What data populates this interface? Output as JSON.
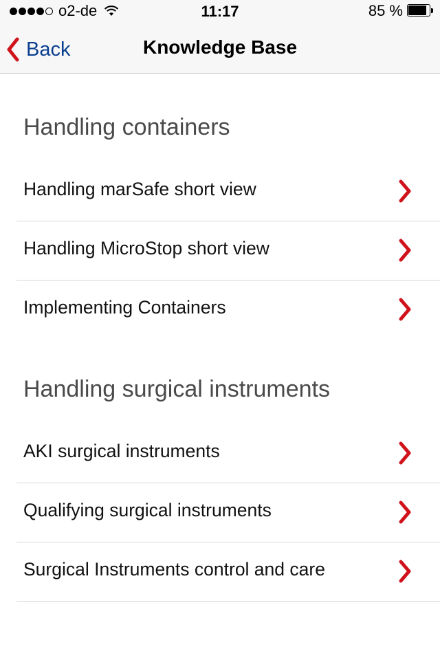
{
  "status_bar": {
    "carrier": "o2-de",
    "time": "11:17",
    "battery_percent": "85 %",
    "battery_level": 0.85,
    "signal_bars_filled": 4,
    "signal_bars_total": 5
  },
  "nav": {
    "back_label": "Back",
    "title": "Knowledge Base"
  },
  "sections": [
    {
      "header": "Handling containers",
      "items": [
        {
          "label": "Handling marSafe short view"
        },
        {
          "label": "Handling MicroStop short view"
        },
        {
          "label": "Implementing Containers"
        }
      ]
    },
    {
      "header": "Handling surgical instruments",
      "items": [
        {
          "label": "AKI surgical instruments"
        },
        {
          "label": "Qualifying surgical instruments"
        },
        {
          "label": "Surgical Instruments control and care"
        }
      ]
    }
  ],
  "colors": {
    "accent_red": "#d0121b",
    "back_blue": "#0a3f8f",
    "section_header_gray": "#4a4a4a"
  },
  "icons": {
    "row_disclosure": "chevron-right-icon",
    "back": "chevron-left-icon",
    "wifi": "wifi-icon",
    "battery": "battery-icon"
  }
}
